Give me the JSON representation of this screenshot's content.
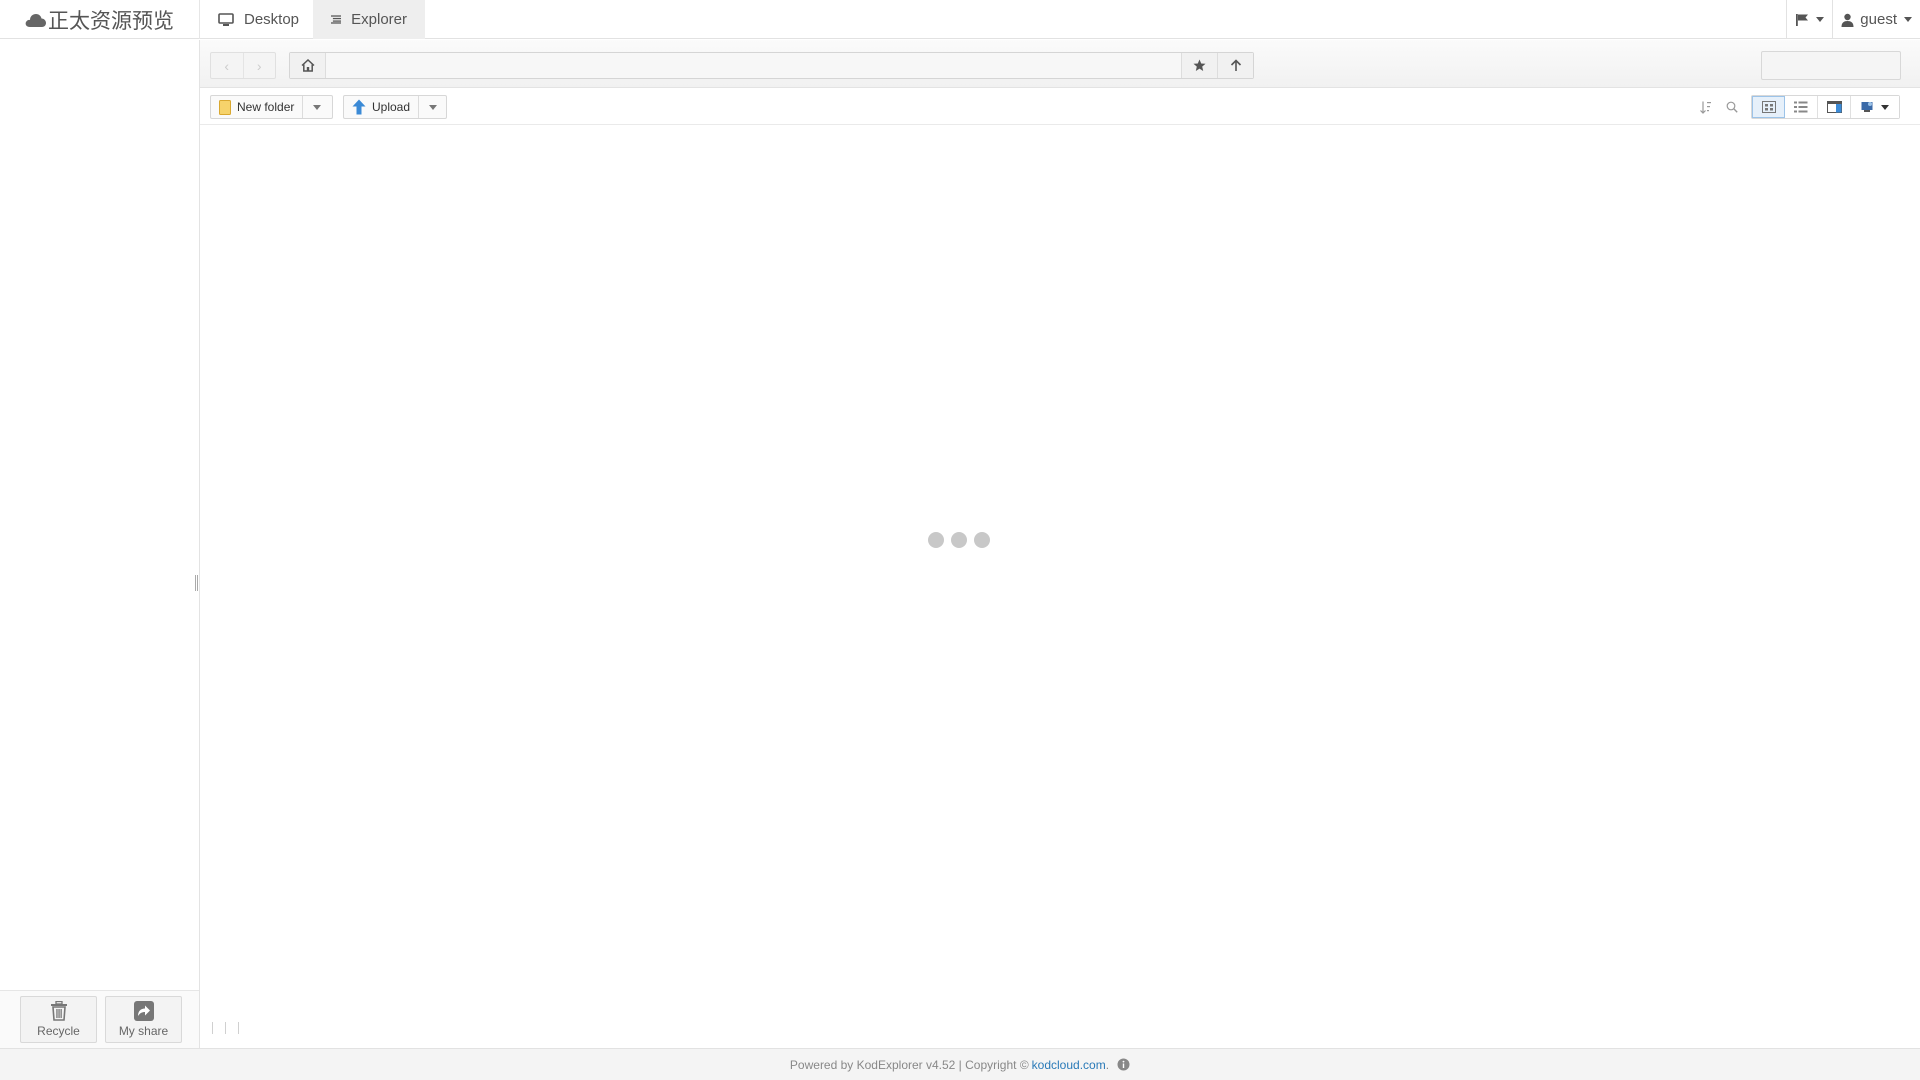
{
  "app": {
    "brand_title": "正太资源预览",
    "brand_icon": "cloud-icon"
  },
  "nav": {
    "tabs": [
      {
        "label": "Desktop",
        "icon": "monitor-icon",
        "active": false
      },
      {
        "label": "Explorer",
        "icon": "list-icon",
        "active": true
      }
    ],
    "right": {
      "flag_icon": "flag-icon",
      "user_label": "guest",
      "user_icon": "user-icon"
    }
  },
  "pathbar": {
    "back_icon": "chevron-left-icon",
    "forward_icon": "chevron-right-icon",
    "home_icon": "home-icon",
    "address_value": "",
    "favorite_icon": "star-icon",
    "up_icon": "arrow-up-icon",
    "search_value": "",
    "search_icon": "search-icon"
  },
  "toolbar": {
    "new_folder_label": "New folder",
    "upload_label": "Upload",
    "sort_icon": "sort-icon",
    "zoom_icon": "zoom-icon",
    "views": [
      "grid-view-icon",
      "list-view-icon",
      "split-view-icon",
      "theme-icon"
    ],
    "active_view": "grid-view-icon"
  },
  "sidebar": {
    "recycle_label": "Recycle",
    "myshare_label": "My share"
  },
  "footer": {
    "text": "Powered by KodExplorer v4.52 | Copyright ©",
    "link": "kodcloud.com",
    "suffix": "."
  },
  "colors": {
    "link": "#2a7ab8",
    "active_view_bg": "#e6f0fa",
    "loader_dot": "#c8c8c8"
  }
}
